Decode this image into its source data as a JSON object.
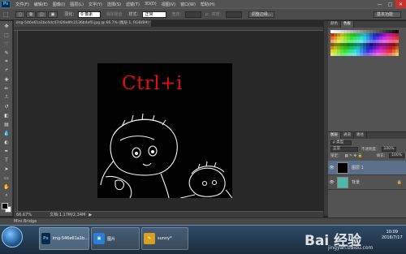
{
  "app": {
    "logo": "Ps"
  },
  "menu": [
    "文件(F)",
    "编辑(E)",
    "图像(I)",
    "图层(L)",
    "文字(Y)",
    "选择(S)",
    "滤镜(T)",
    "3D(D)",
    "视图(V)",
    "窗口(W)",
    "帮助(H)"
  ],
  "window_controls": {
    "minimize": "—",
    "maximize": "□",
    "close": "✕"
  },
  "options": {
    "feather_label": "羽化：",
    "feather_value": "0 像素",
    "antialias": "消除锯齿",
    "style_label": "样式：",
    "style_value": "正常",
    "width_label": "宽度：",
    "height_label": "高度：",
    "refine_btn": "调整边缘...",
    "workspace": "基本功能"
  },
  "document": {
    "tab": "img-546e61a1bc4dc47d26e8fc2136b4ef0.jpg @ 66.7% (图层 1, RGB/8#) * ✕",
    "canvas_text": "Ctrl+i",
    "canvas_bg": "#000000",
    "text_color": "#e01010"
  },
  "status": {
    "zoom": "66.67%",
    "doc": "文档:1.17M/2.34M"
  },
  "mini_bridge": "Mini Bridge",
  "panels": {
    "color_tabs": [
      "颜色",
      "色板"
    ],
    "layer_tabs": [
      "图层",
      "通道",
      "路径"
    ],
    "kind_label": "ρ 类型",
    "blend_mode": "正常",
    "opacity_label": "不透明度：",
    "opacity_value": "100%",
    "lock_label": "锁定：",
    "fill_label": "填充：",
    "fill_value": "100%",
    "layers": [
      {
        "name": "图层 1",
        "selected": true,
        "thumb": "#000000"
      },
      {
        "name": "背景",
        "selected": false,
        "thumb": "#4fb8a8"
      }
    ]
  },
  "taskbar": {
    "tasks": [
      {
        "label": "img-546e61a1b...",
        "icon": "Ps",
        "icon_color": "#0a2a45",
        "active": true
      },
      {
        "label": "图片",
        "icon": "▣",
        "icon_color": "#2a7fd4",
        "active": false
      },
      {
        "label": "sunny*",
        "icon": "✎",
        "icon_color": "#d9a020",
        "active": false
      }
    ],
    "clock_time": "10:09",
    "clock_date": "2016/7/17"
  },
  "watermark": {
    "brand": "Bai 经验",
    "url": "jingyan.baidu.com"
  }
}
